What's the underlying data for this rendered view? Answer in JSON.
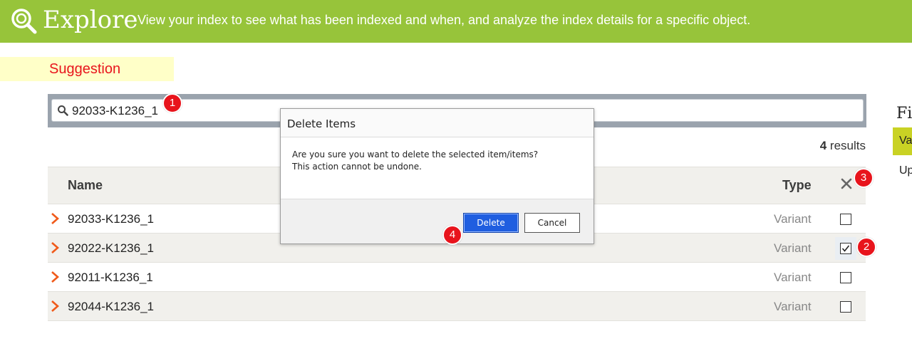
{
  "header": {
    "title": "Explore",
    "subtitle": "View your index to see what has been indexed and when, and analyze the index details for a specific object.",
    "icon": "zoom-in-icon"
  },
  "suggestion_label": "Suggestion",
  "search": {
    "value": "92033-K1236_1",
    "icon": "search-icon"
  },
  "results": {
    "count": "4",
    "label": "results"
  },
  "table": {
    "columns": {
      "name": "Name",
      "type": "Type"
    },
    "rows": [
      {
        "name": "92033-K1236_1",
        "type": "Variant",
        "checked": false
      },
      {
        "name": "92022-K1236_1",
        "type": "Variant",
        "checked": true
      },
      {
        "name": "92011-K1236_1",
        "type": "Variant",
        "checked": false
      },
      {
        "name": "92044-K1236_1",
        "type": "Variant",
        "checked": false
      }
    ]
  },
  "filters": {
    "title": "Fi",
    "selected": "Va",
    "item": "Up"
  },
  "dialog": {
    "title": "Delete Items",
    "message_line1": "Are you sure you want to delete the selected item/items?",
    "message_line2": "This action cannot be undone.",
    "delete_label": "Delete",
    "cancel_label": "Cancel"
  },
  "callouts": {
    "c1": "1",
    "c2": "2",
    "c3": "3",
    "c4": "4"
  },
  "colors": {
    "header_bg": "#97c43a",
    "accent_red": "#e8141c",
    "primary_button": "#1f5ee0",
    "filter_selected": "#c9d224",
    "chevron": "#f05a1a"
  }
}
